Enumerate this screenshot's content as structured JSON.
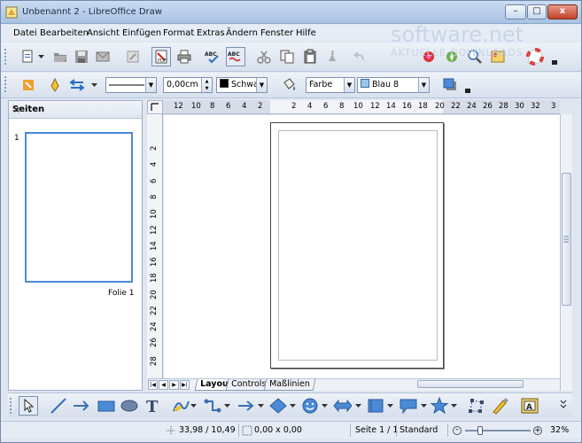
{
  "window": {
    "title": "Unbenannt 2 - LibreOffice Draw",
    "minimize_label": "–",
    "maximize_label": "□",
    "close_label": "x"
  },
  "menu": {
    "items": [
      "Datei",
      "Bearbeiten",
      "Ansicht",
      "Einfügen",
      "Format",
      "Extras",
      "Ändern",
      "Fenster",
      "Hilfe"
    ]
  },
  "watermark": {
    "line1": "software.net",
    "line2": "AKTUELLE DOWNLOADS"
  },
  "line_bar": {
    "line_width": "0,00cm",
    "line_color": "Schwarz",
    "area_style": "Farbe",
    "area_color": "Blau 8",
    "line_color_hex": "#000000",
    "area_color_hex": "#9dc3e6"
  },
  "slides_panel": {
    "title": "Seiten",
    "close": "×",
    "slide_number": "1",
    "slide_label": "Folie 1"
  },
  "hruler": {
    "marks": [
      "12",
      "10",
      "8",
      "6",
      "4",
      "2",
      "2",
      "4",
      "6",
      "8",
      "10",
      "12",
      "14",
      "16",
      "18",
      "20",
      "22",
      "24",
      "26",
      "28",
      "30",
      "32",
      "3"
    ]
  },
  "vruler": {
    "marks": [
      "2",
      "4",
      "6",
      "8",
      "10",
      "12",
      "14",
      "16",
      "18",
      "20",
      "22",
      "24",
      "26",
      "28"
    ]
  },
  "tabs": {
    "items": [
      "Layout",
      "Controls",
      "Maßlinien"
    ]
  },
  "status": {
    "position": "33,98 / 10,49",
    "size": "0,00 x 0,00",
    "page": "Seite 1 / 1",
    "style": "Standard",
    "zoom": "32%"
  }
}
